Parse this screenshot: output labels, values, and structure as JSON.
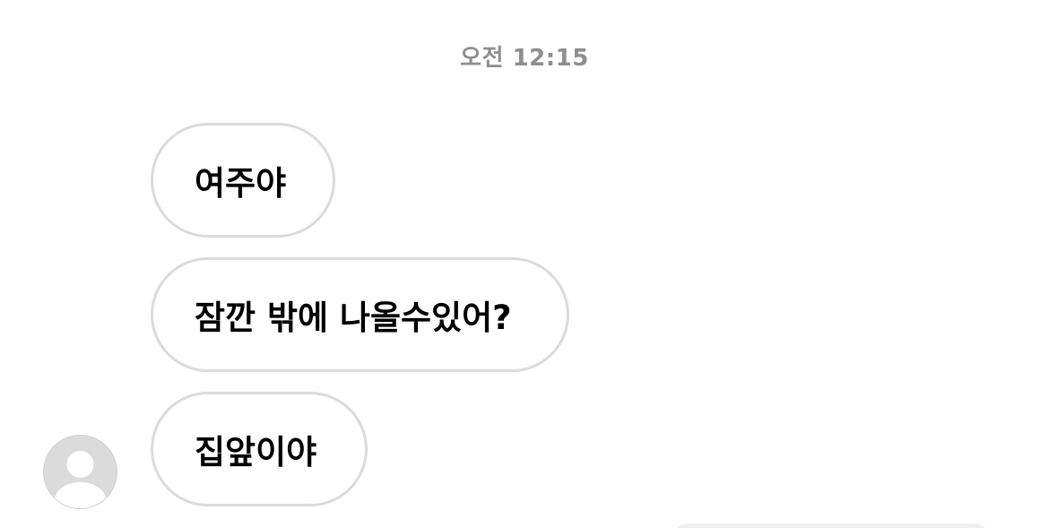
{
  "thread": {
    "timestamp": "오전 12:15",
    "messages": [
      {
        "text": "여주야"
      },
      {
        "text": "잠깐 밖에 나올수있어?"
      },
      {
        "text": "집앞이야"
      }
    ]
  },
  "colors": {
    "bubble_border": "#dbdbdb",
    "timestamp_text": "#8e8e8e",
    "avatar_placeholder": "#dbdbdb",
    "outgoing_bubble": "#efefef"
  },
  "icons": {
    "avatar": "default-profile-icon"
  }
}
